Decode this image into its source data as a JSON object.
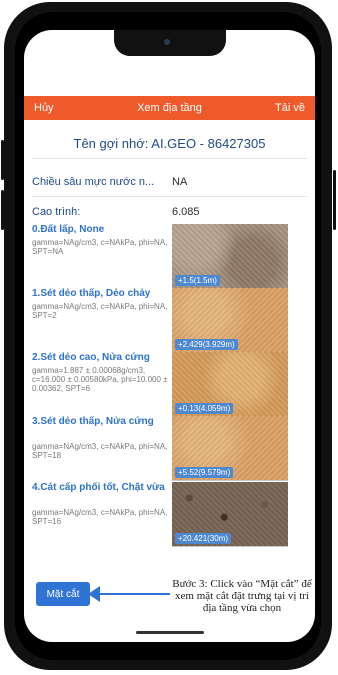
{
  "topbar": {
    "cancel_label": "Hủy",
    "title": "Xem địa tầng",
    "reload_label": "Tải về",
    "bg_color": "#ef5a2a"
  },
  "header": {
    "title": "Tên gợi nhớ: AI.GEO - 86427305"
  },
  "info": {
    "water_depth_label": "Chiều sâu mực nước n...",
    "water_depth_value": "NA",
    "elevation_label": "Cao trình:",
    "elevation_value": "6.085"
  },
  "layers": [
    {
      "name": "0.Đất lấp, None",
      "params": "gamma=NAg/cm3, c=NAkPa, phi=NA, SPT=NA",
      "depth": "+1.5(1.5m)",
      "texture": "fill-soil"
    },
    {
      "name": "1.Sét dẻo thấp, Dẻo chảy",
      "params": "gamma=NAg/cm3, c=NAkPa, phi=NA, SPT=2",
      "depth": "+2.429(3.929m)",
      "texture": "clay-sand"
    },
    {
      "name": "2.Sét dẻo cao, Nửa cứng",
      "params": "gamma=1.887 ± 0.00068g/cm3, c=16.000 ± 0.00580kPa, phi=10.000 ± 0.00362, SPT=6",
      "depth": "+0.13(4.059m)",
      "texture": "clay-sand"
    },
    {
      "name": "3.Sét dẻo thấp, Nửa cứng",
      "params": "gamma=NAg/cm3, c=NAkPa, phi=NA, SPT=18",
      "depth": "+5.52(9.579m)",
      "texture": "clay-sand"
    },
    {
      "name": "4.Cát cấp phối tốt, Chặt vừa",
      "params": "gamma=NAg/cm3, c=NAkPa, phi=NA, SPT=16",
      "depth": "+20.421(30m)",
      "texture": "gravel-sand"
    }
  ],
  "actions": {
    "section_button": "Mặt cắt"
  },
  "annotation": {
    "text": "Bước 3: Click vào “Mặt cắt” để xem mặt cắt đặt trưng tại vị trí địa tầng vừa chọn"
  },
  "accent_color": "#2f73d4"
}
